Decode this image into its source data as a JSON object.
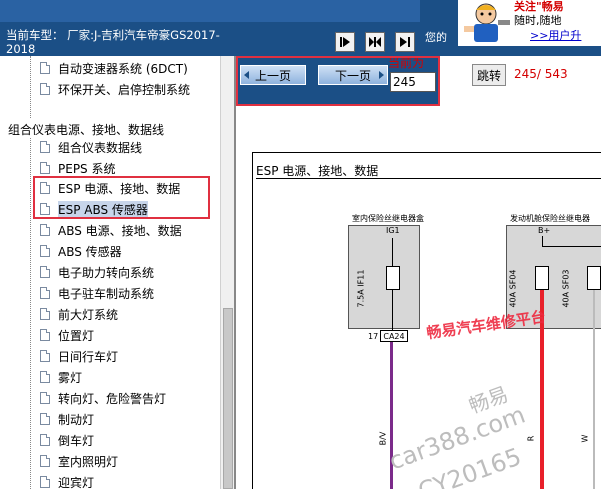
{
  "header": {
    "car_model_label": "当前车型：",
    "car_model_value": "厂家:J-吉利汽车帝豪GS2017-2018",
    "welcome_text": "您的"
  },
  "ad": {
    "attention": "关注\"畅易",
    "anytime": "随时,随地",
    "user_link": ">>用户升"
  },
  "toolbar": {
    "buttons": [
      {
        "icon": "play-icon"
      },
      {
        "icon": "double-arrow-icon"
      },
      {
        "icon": "play-icon"
      }
    ]
  },
  "tree": {
    "items": [
      {
        "label": "自动变速器系统 (6DCT)",
        "indent": 1
      },
      {
        "label": "环保开关、启停控制系统",
        "indent": 1
      },
      {
        "label": "组合仪表电源、接地、数据线",
        "indent": 0
      },
      {
        "label": "组合仪表数据线",
        "indent": 1
      },
      {
        "label": "PEPS 系统",
        "indent": 1
      },
      {
        "label": "ESP 电源、接地、数据",
        "indent": 1
      },
      {
        "label": "ESP ABS 传感器",
        "indent": 1,
        "selected": true
      },
      {
        "label": "ABS 电源、接地、数据",
        "indent": 1
      },
      {
        "label": "ABS 传感器",
        "indent": 1
      },
      {
        "label": "电子助力转向系统",
        "indent": 1
      },
      {
        "label": "电子驻车制动系统",
        "indent": 1
      },
      {
        "label": "前大灯系统",
        "indent": 1
      },
      {
        "label": "位置灯",
        "indent": 1
      },
      {
        "label": "日间行车灯",
        "indent": 1
      },
      {
        "label": "雾灯",
        "indent": 1
      },
      {
        "label": "转向灯、危险警告灯",
        "indent": 1
      },
      {
        "label": "制动灯",
        "indent": 1
      },
      {
        "label": "倒车灯",
        "indent": 1
      },
      {
        "label": "室内照明灯",
        "indent": 1
      },
      {
        "label": "迎宾灯",
        "indent": 1
      }
    ]
  },
  "pager": {
    "prev_label": "上一页",
    "next_label": "下一页",
    "current_label": "当前为",
    "current_value": "245",
    "jump_label": "跳转",
    "page_count": "245/ 543"
  },
  "diagram": {
    "title": "ESP 电源、接地、数据",
    "left_box_label": "室内保险丝继电器盒",
    "left_pin": "IG1",
    "left_fuse": "7.5A IF11",
    "left_connector_num": "17",
    "left_connector": "CA24",
    "left_wire": "B/V",
    "right_box_label": "发动机舱保险丝继电器",
    "right_pin": "B+",
    "right_fuse_1": "40A SF04",
    "right_fuse_2": "40A SF03",
    "right_wire_1": "R",
    "right_wire_2": "W"
  },
  "watermark": {
    "red": "畅易汽车维修平台",
    "grey_1": "畅易",
    "grey_2": "car388.com",
    "grey_3": "CY20165"
  },
  "colors": {
    "header_blue": "#1b4f86",
    "highlight_red": "#e03040",
    "page_red": "#d40000",
    "wire_purple": "#7b2a8a",
    "wire_red": "#e8202a"
  }
}
